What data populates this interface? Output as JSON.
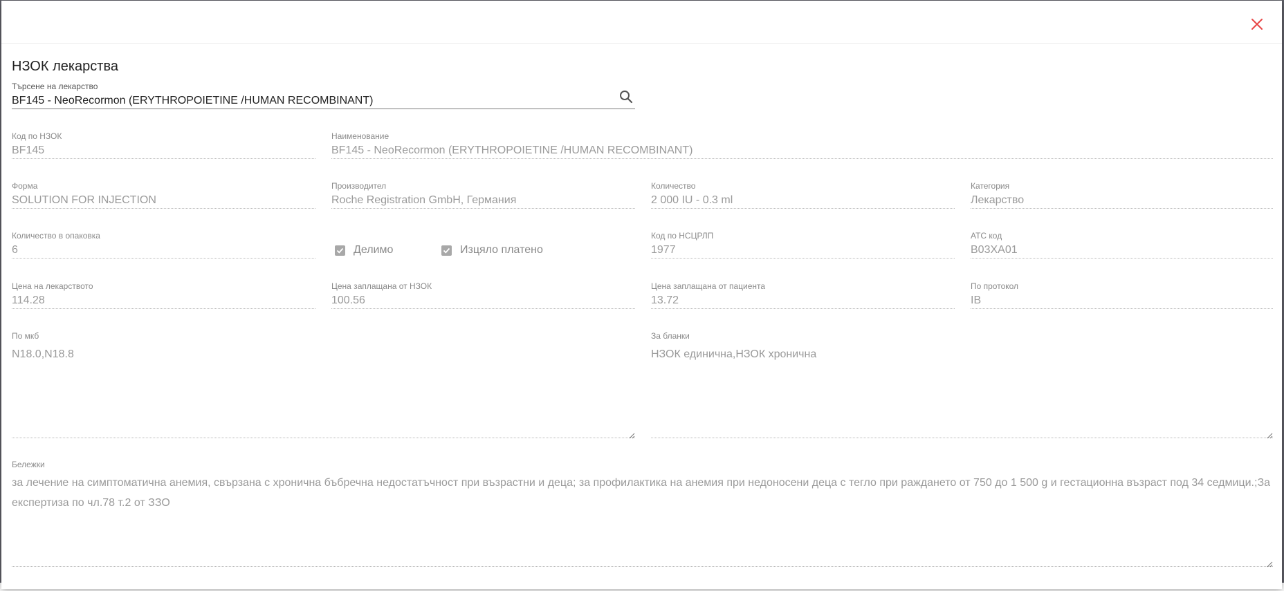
{
  "dialog": {
    "title": "НЗОК лекарства",
    "close_icon": "close-icon"
  },
  "search": {
    "label": "Търсене на лекарство",
    "value": "BF145 - NeoRecormon (ERYTHROPOIETINE /HUMAN RECOMBINANT)",
    "icon": "search-icon"
  },
  "fields": {
    "nzok_code": {
      "label": "Код по НЗОК",
      "value": "BF145"
    },
    "name": {
      "label": "Наименование",
      "value": "BF145 - NeoRecormon (ERYTHROPOIETINE /HUMAN RECOMBINANT)"
    },
    "form": {
      "label": "Форма",
      "value": "SOLUTION FOR INJECTION"
    },
    "manufacturer": {
      "label": "Производител",
      "value": "Roche Registration GmbH, Германия"
    },
    "quantity": {
      "label": "Количество",
      "value": "2 000 IU - 0.3 ml"
    },
    "category": {
      "label": "Категория",
      "value": "Лекарство"
    },
    "pack_quantity": {
      "label": "Количество в опаковка",
      "value": "6"
    },
    "nscrlp_code": {
      "label": "Код по НСЦРЛП",
      "value": "1977"
    },
    "atc_code": {
      "label": "АТС код",
      "value": "B03XA01"
    },
    "price": {
      "label": "Цена на лекарството",
      "value": "114.28"
    },
    "nzok_paid": {
      "label": "Цена заплащана от НЗОК",
      "value": "100.56"
    },
    "patient_paid": {
      "label": "Цена заплащана от пациента",
      "value": "13.72"
    },
    "protocol": {
      "label": "По протокол",
      "value": "IB"
    },
    "mkb": {
      "label": "По мкб",
      "value": "N18.0,N18.8"
    },
    "forms": {
      "label": "За бланки",
      "value": "НЗОК единична,НЗОК хронична"
    },
    "notes": {
      "label": "Бележки",
      "value": "за лечение на симптоматична анемия, свързана с хронична бъбречна недостатъчност при възрастни и деца; за профилактика на анемия при недоносени деца с тегло при раждането от 750 до 1 500 g и гестационна възраст под 34 седмици.;За експертиза по чл.78 т.2 от ЗЗО"
    }
  },
  "checkboxes": {
    "divisible": {
      "label": "Делимо",
      "checked": true
    },
    "fully_paid": {
      "label": "Изцяло платено",
      "checked": true
    }
  }
}
